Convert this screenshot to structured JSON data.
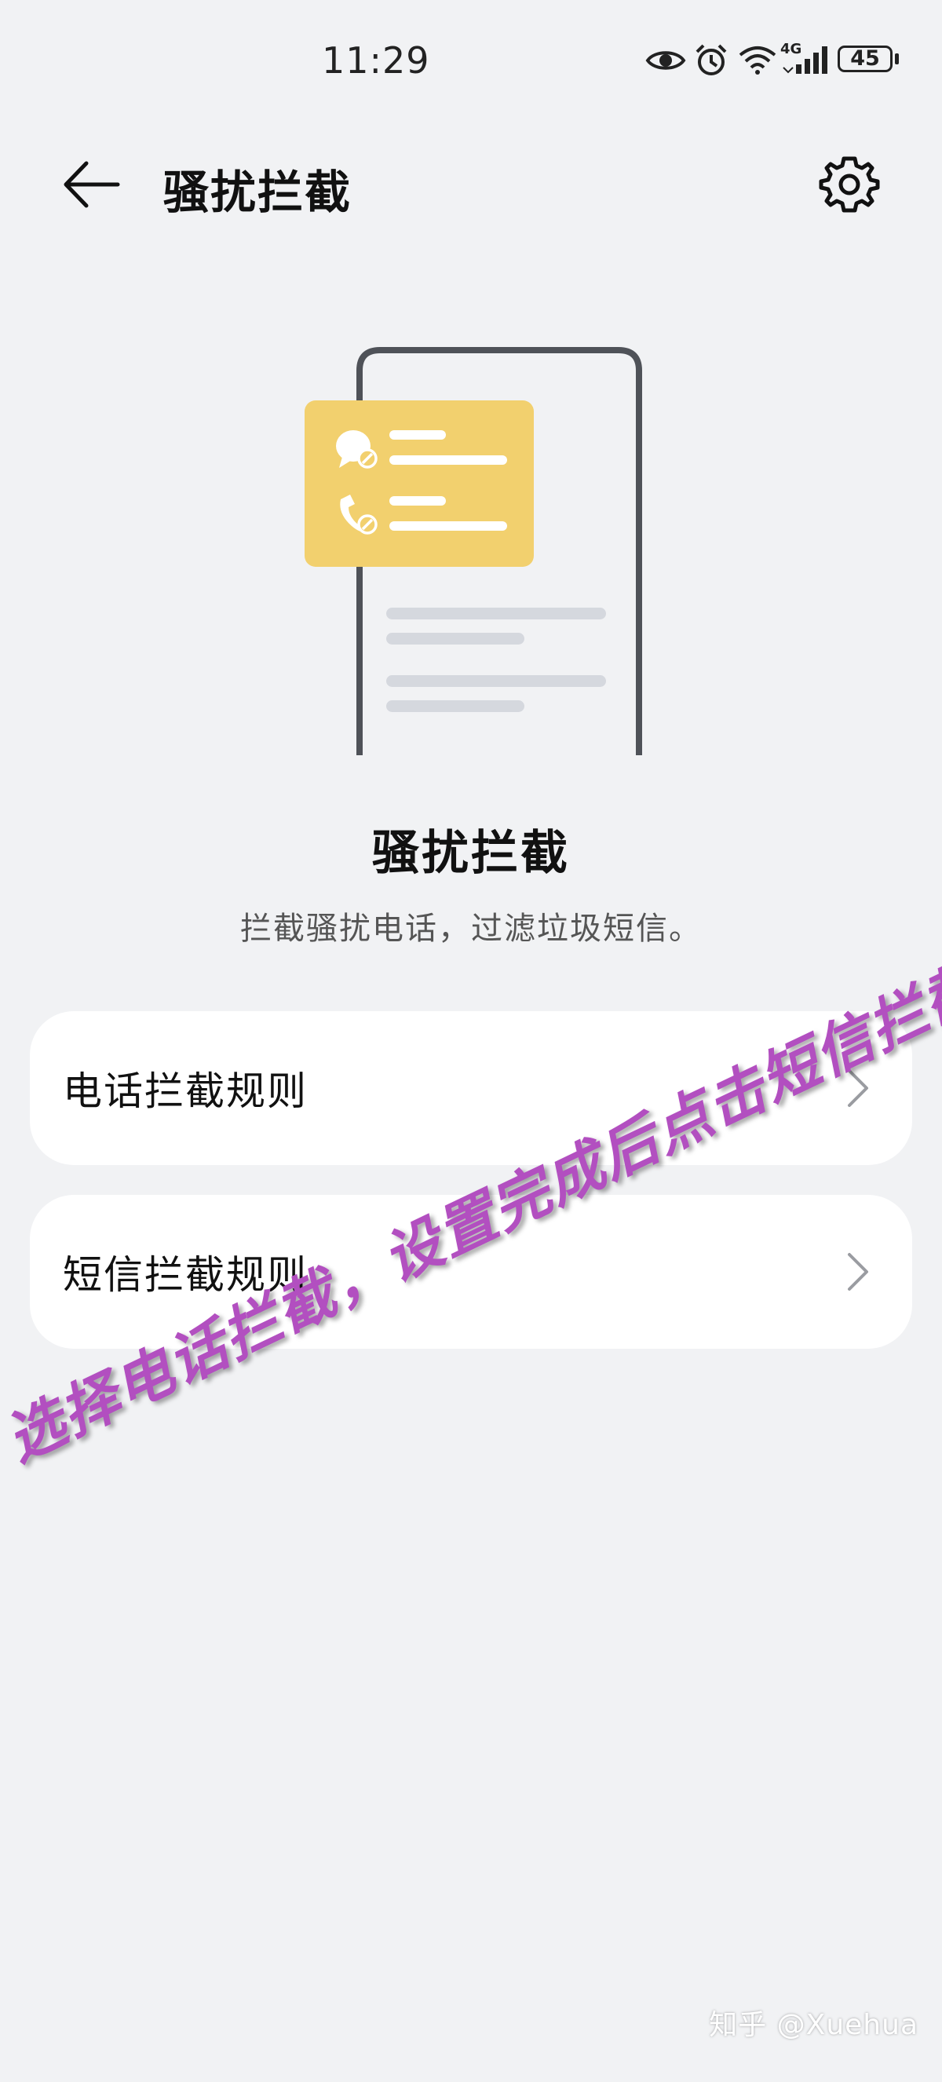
{
  "status_bar": {
    "time": "11:29",
    "network": "4G",
    "battery": "45",
    "icons": [
      "eye-icon",
      "alarm-icon",
      "wifi-icon",
      "signal-icon",
      "battery-icon"
    ]
  },
  "header": {
    "title": "骚扰拦截",
    "back_icon": "back-arrow-icon",
    "settings_icon": "gear-icon"
  },
  "hero": {
    "title": "骚扰拦截",
    "subtitle": "拦截骚扰电话，过滤垃圾短信。"
  },
  "menu": {
    "items": [
      {
        "label": "电话拦截规则"
      },
      {
        "label": "短信拦截规则"
      }
    ]
  },
  "annotation": {
    "text": "选择电话拦截，设置完成后点击短信拦截"
  },
  "watermark": {
    "text": "知乎 @Xuehua"
  },
  "colors": {
    "background": "#f1f2f4",
    "card": "#ffffff",
    "accent_yellow": "#f2d06e",
    "annotation": "#b24fc0"
  }
}
